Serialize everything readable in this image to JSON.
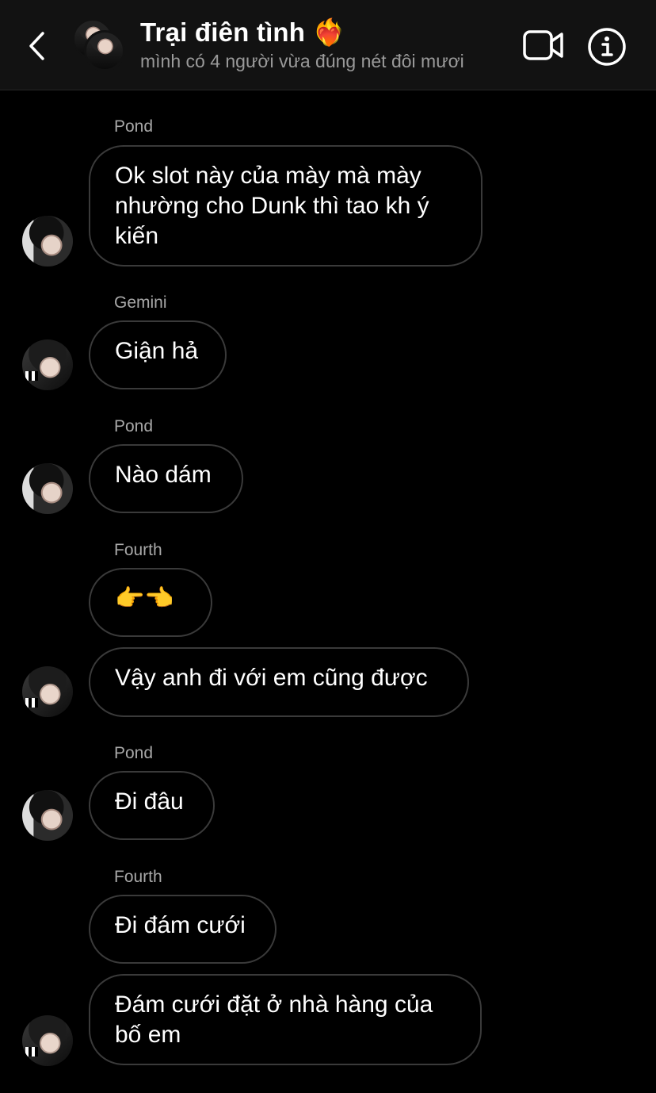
{
  "header": {
    "title": "Trại điên tình ❤️‍🔥",
    "subtitle": "mình có 4 người vừa đúng nét đôi mươi",
    "back_icon": "chevron-left-icon",
    "video_icon": "video-camera-icon",
    "info_icon": "info-icon"
  },
  "messages": [
    {
      "sender": "Pond",
      "text": "Ok slot này của mày mà mày\nnhường cho Dunk thì tao kh ý\nkiến"
    },
    {
      "sender": "Gemini",
      "text": "Giận hả"
    },
    {
      "sender": "Pond",
      "text": "Nào dám"
    },
    {
      "sender": "Fourth",
      "text": "👉👈"
    },
    {
      "sender": "",
      "text": "Vậy anh đi với em cũng được"
    },
    {
      "sender": "Pond",
      "text": "Đi đâu"
    },
    {
      "sender": "Fourth",
      "text": "Đi đám cưới"
    },
    {
      "sender": "",
      "text": "Đám cưới đặt ở nhà hàng của\nbố em"
    }
  ],
  "colors": {
    "background": "#000000",
    "header_bg": "#121212",
    "bubble_border": "#3a3a3a",
    "sender_name": "#a8a8a8",
    "subtitle": "#9a9a9a"
  }
}
